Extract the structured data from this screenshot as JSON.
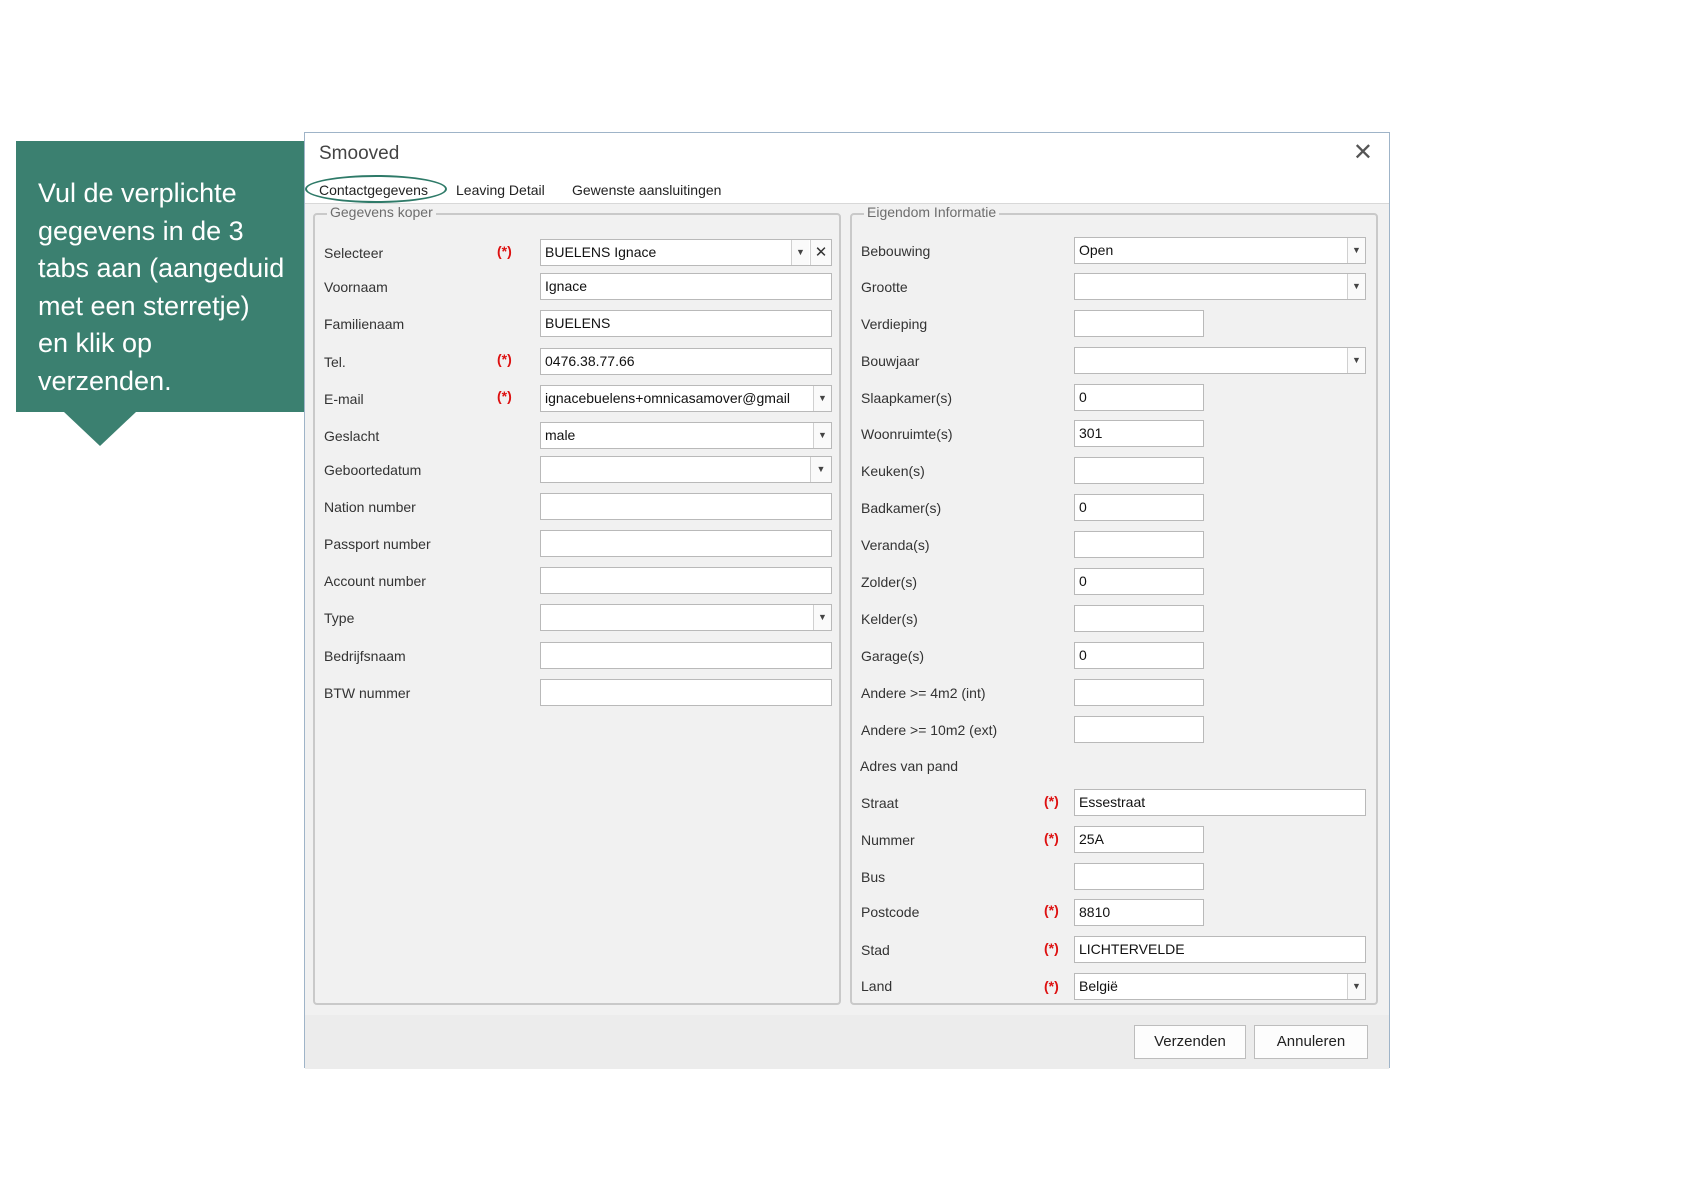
{
  "callout": {
    "text": "Vul de verplichte\ngegevens in de 3\ntabs aan (aangeduid\nmet een sterretje)\nen klik op\nverzenden."
  },
  "dialog": {
    "title": "Smooved",
    "close_icon": "close-icon",
    "tabs": [
      {
        "label": "Contactgegevens",
        "active": true
      },
      {
        "label": "Leaving Detail",
        "active": false
      },
      {
        "label": "Gewenste aansluitingen",
        "active": false
      }
    ],
    "accent_color": "#2e7a68"
  },
  "koper": {
    "legend": "Gegevens koper",
    "required_marker": "(*)",
    "fields": {
      "selecteer": {
        "label": "Selecteer",
        "value": "BUELENS Ignace"
      },
      "voornaam": {
        "label": "Voornaam",
        "value": "Ignace"
      },
      "familienaam": {
        "label": "Familienaam",
        "value": "BUELENS"
      },
      "tel": {
        "label": "Tel.",
        "value": "0476.38.77.66"
      },
      "email": {
        "label": "E-mail",
        "value": "ignacebuelens+omnicasamover@gmail"
      },
      "geslacht": {
        "label": "Geslacht",
        "value": "male"
      },
      "geboortedatum": {
        "label": "Geboortedatum",
        "value": ""
      },
      "nation": {
        "label": "Nation number",
        "value": ""
      },
      "passport": {
        "label": "Passport number",
        "value": ""
      },
      "account": {
        "label": "Account number",
        "value": ""
      },
      "type": {
        "label": "Type",
        "value": ""
      },
      "bedrijfsnaam": {
        "label": "Bedrijfsnaam",
        "value": ""
      },
      "btw": {
        "label": "BTW nummer",
        "value": ""
      }
    }
  },
  "eigendom": {
    "legend": "Eigendom Informatie",
    "required_marker": "(*)",
    "fields": {
      "bebouwing": {
        "label": "Bebouwing",
        "value": "Open"
      },
      "grootte": {
        "label": "Grootte",
        "value": ""
      },
      "verdieping": {
        "label": "Verdieping",
        "value": ""
      },
      "bouwjaar": {
        "label": "Bouwjaar",
        "value": ""
      },
      "slaapkamers": {
        "label": "Slaapkamer(s)",
        "value": "0"
      },
      "woonruimtes": {
        "label": "Woonruimte(s)",
        "value": "301"
      },
      "keukens": {
        "label": "Keuken(s)",
        "value": ""
      },
      "badkamers": {
        "label": "Badkamer(s)",
        "value": "0"
      },
      "verandas": {
        "label": "Veranda(s)",
        "value": ""
      },
      "zolders": {
        "label": "Zolder(s)",
        "value": "0"
      },
      "kelders": {
        "label": "Kelder(s)",
        "value": ""
      },
      "garages": {
        "label": "Garage(s)",
        "value": "0"
      },
      "andere_int": {
        "label": "Andere >= 4m2 (int)",
        "value": ""
      },
      "andere_ext": {
        "label": "Andere >= 10m2 (ext)",
        "value": ""
      }
    },
    "adres_heading": "Adres van pand",
    "adres": {
      "straat": {
        "label": "Straat",
        "value": "Essestraat"
      },
      "nummer": {
        "label": "Nummer",
        "value": "25A"
      },
      "bus": {
        "label": "Bus",
        "value": ""
      },
      "postcode": {
        "label": "Postcode",
        "value": "8810"
      },
      "stad": {
        "label": "Stad",
        "value": "LICHTERVELDE"
      },
      "land": {
        "label": "Land",
        "value": "België"
      }
    }
  },
  "buttons": {
    "submit": "Verzenden",
    "cancel": "Annuleren"
  }
}
